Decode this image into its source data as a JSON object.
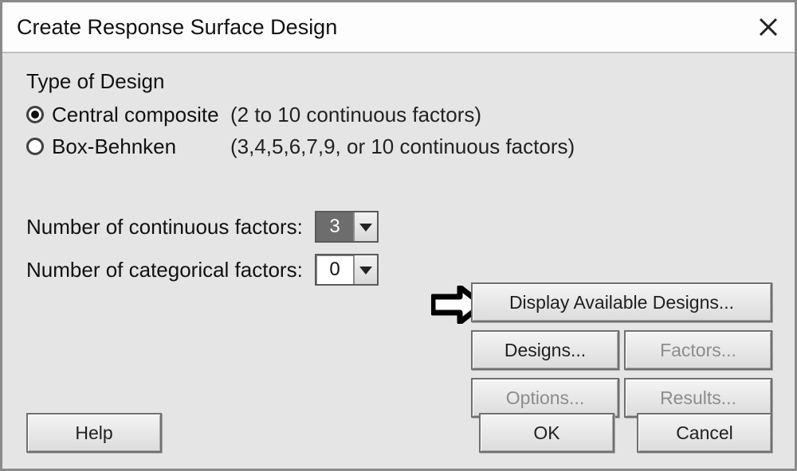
{
  "dialog": {
    "title": "Create Response Surface Design"
  },
  "design_type": {
    "section_label": "Type of Design",
    "options": [
      {
        "label": "Central composite",
        "hint": "(2 to 10 continuous factors)",
        "selected": true
      },
      {
        "label": "Box-Behnken",
        "hint": "(3,4,5,6,7,9, or 10 continuous factors)",
        "selected": false
      }
    ]
  },
  "factors": {
    "continuous_label": "Number of continuous factors:",
    "continuous_value": "3",
    "categorical_label": "Number of categorical factors:",
    "categorical_value": "0"
  },
  "buttons": {
    "display_designs": "Display Available Designs...",
    "designs": "Designs...",
    "factors": "Factors...",
    "options": "Options...",
    "results": "Results...",
    "help": "Help",
    "ok": "OK",
    "cancel": "Cancel"
  }
}
